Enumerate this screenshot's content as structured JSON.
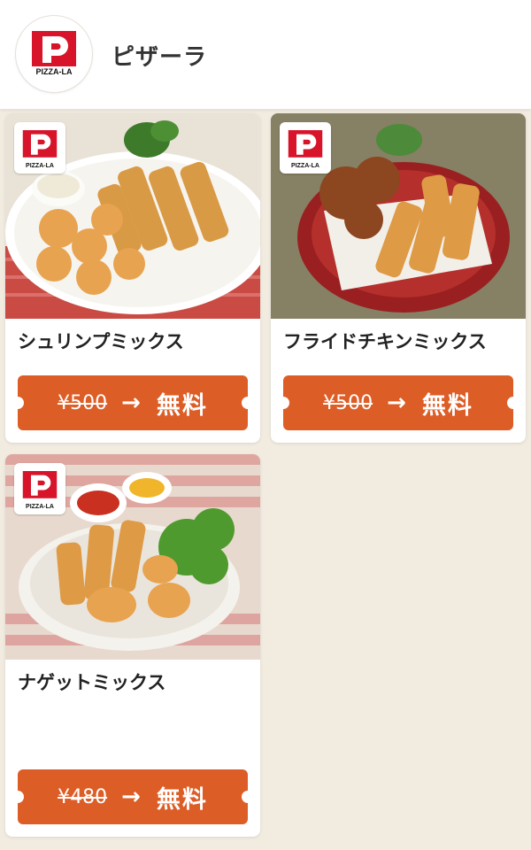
{
  "header": {
    "brand_logo_text": "PIZZA-LA",
    "title": "ピザーラ"
  },
  "coupons": [
    {
      "name": "シュリンプミックス",
      "old_price": "¥500",
      "arrow": "→",
      "offer": "無料",
      "badge_text": "PIZZA-LA"
    },
    {
      "name": "フライドチキンミックス",
      "old_price": "¥500",
      "arrow": "→",
      "offer": "無料",
      "badge_text": "PIZZA-LA"
    },
    {
      "name": "ナゲットミックス",
      "old_price": "¥480",
      "arrow": "→",
      "offer": "無料",
      "badge_text": "PIZZA-LA"
    }
  ],
  "colors": {
    "accent": "#dd5d26",
    "background": "#f1ebe0",
    "brand_red": "#d7142a"
  }
}
